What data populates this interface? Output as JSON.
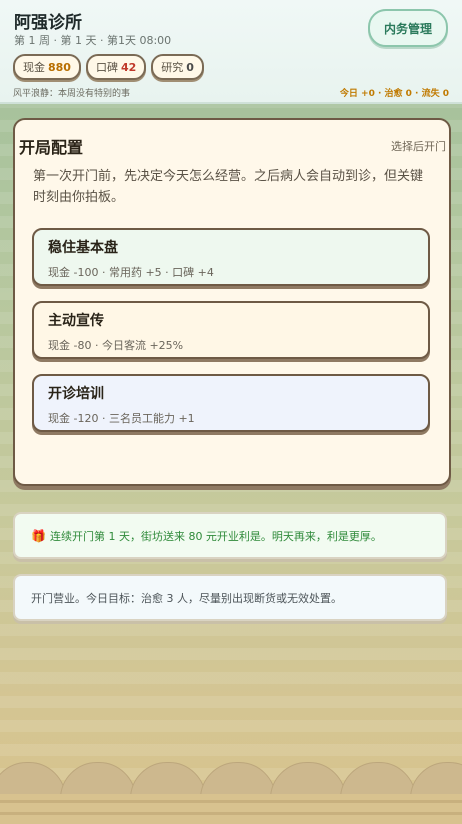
{
  "header": {
    "clinic_name": "阿强诊所",
    "time_line": "第 1 周 · 第 1 天 · 第1天 08:00",
    "manage_button": "内务管理",
    "stats": {
      "cash_label": "现金",
      "cash_value": "880",
      "reputation_label": "口碑",
      "reputation_value": "42",
      "research_label": "研究",
      "research_value": "0"
    },
    "status_line": "风平浪静：本周没有特别的事",
    "daily_summary": "今日 +0 · 治愈 0 · 流失 0"
  },
  "panel": {
    "title": "开局配置",
    "hint": "选择后开门",
    "description": "第一次开门前，先决定今天怎么经营。之后病人会自动到诊，但关键时刻由你拍板。",
    "options": [
      {
        "title": "稳住基本盘",
        "effects": "现金 -100 · 常用药 +5 · 口碑 +4"
      },
      {
        "title": "主动宣传",
        "effects": "现金 -80 · 今日客流 +25%"
      },
      {
        "title": "开诊培训",
        "effects": "现金 -120 · 三名员工能力 +1"
      }
    ]
  },
  "messages": [
    {
      "icon": "gift-icon",
      "text": "连续开门第 1 天，街坊送来 80 元开业利是。明天再来，利是更厚。"
    },
    {
      "text": "开门营业。今日目标：治愈 3 人，尽量别出现断货或无效处置。"
    }
  ],
  "colors": {
    "accent_green": "#2b7a5c",
    "cash": "#b86e00",
    "reputation": "#c0392b",
    "daily_summary": "#c07a00",
    "message_positive": "#2f8a3a"
  }
}
